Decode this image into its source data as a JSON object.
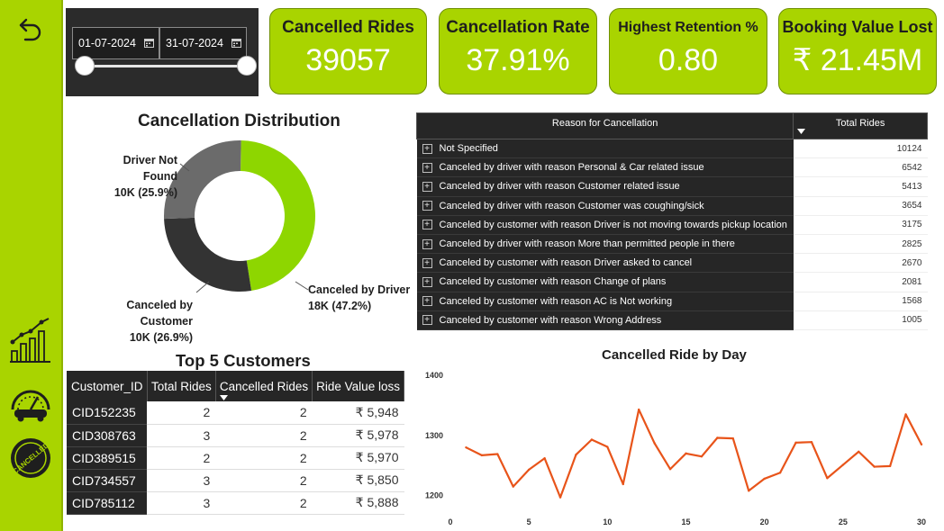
{
  "sidebar": {
    "nav_items": [
      {
        "icon": "back-arrow-icon"
      },
      {
        "icon": "analytics-chart-icon"
      },
      {
        "icon": "speedometer-car-icon"
      },
      {
        "icon": "cancelled-stamp-icon",
        "stamp_text": "CANCELLED"
      }
    ]
  },
  "filter": {
    "start_date": "01-07-2024",
    "end_date": "31-07-2024"
  },
  "kpis": [
    {
      "label": "Cancelled Rides",
      "value": "39057"
    },
    {
      "label": "Cancellation Rate",
      "value": "37.91%"
    },
    {
      "label": "Highest Retention %",
      "value": "0.80"
    },
    {
      "label": "Booking Value Lost",
      "value": "₹ 21.45M"
    }
  ],
  "donut": {
    "title": "Cancellation Distribution",
    "segments": [
      {
        "name": "Canceled by Driver",
        "value_label": "18K (47.2%)",
        "share": 47.2,
        "color": "#8ed600"
      },
      {
        "name": "Canceled by Customer",
        "value_label": "10K (26.9%)",
        "share": 26.9,
        "color": "#333333"
      },
      {
        "name": "Driver Not Found",
        "value_label": "10K (25.9%)",
        "share": 25.9,
        "color": "#6b6b6b"
      }
    ]
  },
  "reasons": {
    "headers": [
      "Reason for Cancellation",
      "Total Rides"
    ],
    "rows": [
      {
        "reason": "Not Specified",
        "count": "10124"
      },
      {
        "reason": "Canceled by driver with reason Personal & Car related issue",
        "count": "6542"
      },
      {
        "reason": "Canceled by driver with reason Customer related issue",
        "count": "5413"
      },
      {
        "reason": "Canceled by driver with reason Customer was coughing/sick",
        "count": "3654"
      },
      {
        "reason": "Canceled by customer with reason Driver is not moving towards pickup location",
        "count": "3175"
      },
      {
        "reason": "Canceled by driver with reason More than permitted people in there",
        "count": "2825"
      },
      {
        "reason": "Canceled by customer with reason Driver asked to cancel",
        "count": "2670"
      },
      {
        "reason": "Canceled by customer with reason Change of plans",
        "count": "2081"
      },
      {
        "reason": "Canceled by customer with reason AC is Not working",
        "count": "1568"
      },
      {
        "reason": "Canceled by customer with reason Wrong Address",
        "count": "1005"
      }
    ]
  },
  "customers": {
    "title": "Top 5 Customers",
    "headers": [
      "Customer_ID",
      "Total Rides",
      "Cancelled Rides",
      "Ride Value loss"
    ],
    "rows": [
      {
        "id": "CID152235",
        "total": "2",
        "cancelled": "2",
        "loss": "₹ 5,948"
      },
      {
        "id": "CID308763",
        "total": "3",
        "cancelled": "2",
        "loss": "₹ 5,978"
      },
      {
        "id": "CID389515",
        "total": "2",
        "cancelled": "2",
        "loss": "₹ 5,970"
      },
      {
        "id": "CID734557",
        "total": "3",
        "cancelled": "2",
        "loss": "₹ 5,850"
      },
      {
        "id": "CID785112",
        "total": "3",
        "cancelled": "2",
        "loss": "₹ 5,888"
      }
    ]
  },
  "chart_data": {
    "type": "line",
    "title": "Cancelled Ride by Day",
    "xlabel": "",
    "ylabel": "",
    "x": [
      1,
      2,
      3,
      4,
      5,
      6,
      7,
      8,
      9,
      10,
      11,
      12,
      13,
      14,
      15,
      16,
      17,
      18,
      19,
      20,
      21,
      22,
      23,
      24,
      25,
      26,
      27,
      28,
      29,
      30
    ],
    "series": [
      {
        "values": [
          1280,
          1267,
          1269,
          1215,
          1243,
          1262,
          1197,
          1268,
          1293,
          1281,
          1219,
          1343,
          1287,
          1244,
          1270,
          1265,
          1296,
          1295,
          1208,
          1228,
          1238,
          1288,
          1289,
          1229,
          1251,
          1273,
          1248,
          1249,
          1335,
          1285
        ],
        "color": "#e8541a"
      }
    ],
    "xlim": [
      0,
      30
    ],
    "ylim": [
      1180,
      1400
    ],
    "xticks": [
      "0",
      "5",
      "10",
      "15",
      "20",
      "25",
      "30"
    ],
    "yticks": [
      "1200",
      "1300",
      "1400"
    ],
    "grid": false,
    "legend": "none"
  }
}
